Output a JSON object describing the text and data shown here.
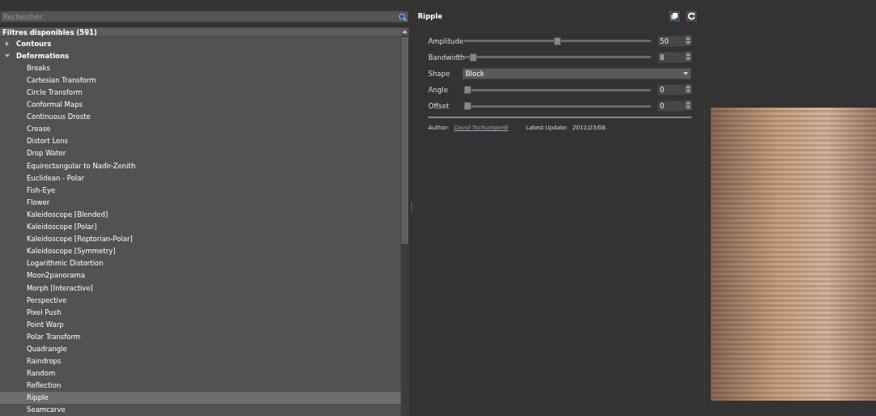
{
  "search": {
    "placeholder": "Rechercher"
  },
  "filter_list": {
    "header": "Filtres disponibles (591)",
    "items": [
      {
        "label": "Contours",
        "expanded": false,
        "selected": false
      },
      {
        "label": "Deformations",
        "expanded": true,
        "selected": false,
        "children": [
          {
            "label": "Breaks",
            "selected": false
          },
          {
            "label": "Cartesian Transform",
            "selected": false
          },
          {
            "label": "Circle Transform",
            "selected": false
          },
          {
            "label": "Conformal Maps",
            "selected": false
          },
          {
            "label": "Continuous Droste",
            "selected": false
          },
          {
            "label": "Crease",
            "selected": false
          },
          {
            "label": "Distort Lens",
            "selected": false
          },
          {
            "label": "Drop Water",
            "selected": false
          },
          {
            "label": "Equirectangular to Nadir-Zenith",
            "selected": false
          },
          {
            "label": "Euclidean - Polar",
            "selected": false
          },
          {
            "label": "Fish-Eye",
            "selected": false
          },
          {
            "label": "Flower",
            "selected": false
          },
          {
            "label": "Kaleidoscope [Blended]",
            "selected": false
          },
          {
            "label": "Kaleidoscope [Polar]",
            "selected": false
          },
          {
            "label": "Kaleidoscope [Reptorian-Polar]",
            "selected": false
          },
          {
            "label": "Kaleidoscope [Symmetry]",
            "selected": false
          },
          {
            "label": "Logarithmic Distortion",
            "selected": false
          },
          {
            "label": "Moon2panorama",
            "selected": false
          },
          {
            "label": "Morph [Interactive]",
            "selected": false
          },
          {
            "label": "Perspective",
            "selected": false
          },
          {
            "label": "Pixel Push",
            "selected": false
          },
          {
            "label": "Point Warp",
            "selected": false
          },
          {
            "label": "Polar Transform",
            "selected": false
          },
          {
            "label": "Quadrangle",
            "selected": false
          },
          {
            "label": "Raindrops",
            "selected": false
          },
          {
            "label": "Random",
            "selected": false
          },
          {
            "label": "Reflection",
            "selected": false
          },
          {
            "label": "Ripple",
            "selected": true
          },
          {
            "label": "Seamcarve",
            "selected": false
          }
        ]
      }
    ]
  },
  "filter": {
    "title": "Ripple",
    "params": [
      {
        "kind": "slider",
        "label": "Amplitude",
        "level": 0.5,
        "value": "50"
      },
      {
        "kind": "slider",
        "label": "Bandwidth",
        "level": 0.03,
        "value": "8"
      },
      {
        "kind": "select",
        "label": "Shape",
        "value": "Block"
      },
      {
        "kind": "slider",
        "label": "Angle",
        "level": 0,
        "value": "0"
      },
      {
        "kind": "slider",
        "label": "Offset",
        "level": 0,
        "value": "0"
      }
    ],
    "author_label": "Author:",
    "author": "David Tschumperlé",
    "update_label": "Latest Update:",
    "update": "2011/23/08."
  }
}
